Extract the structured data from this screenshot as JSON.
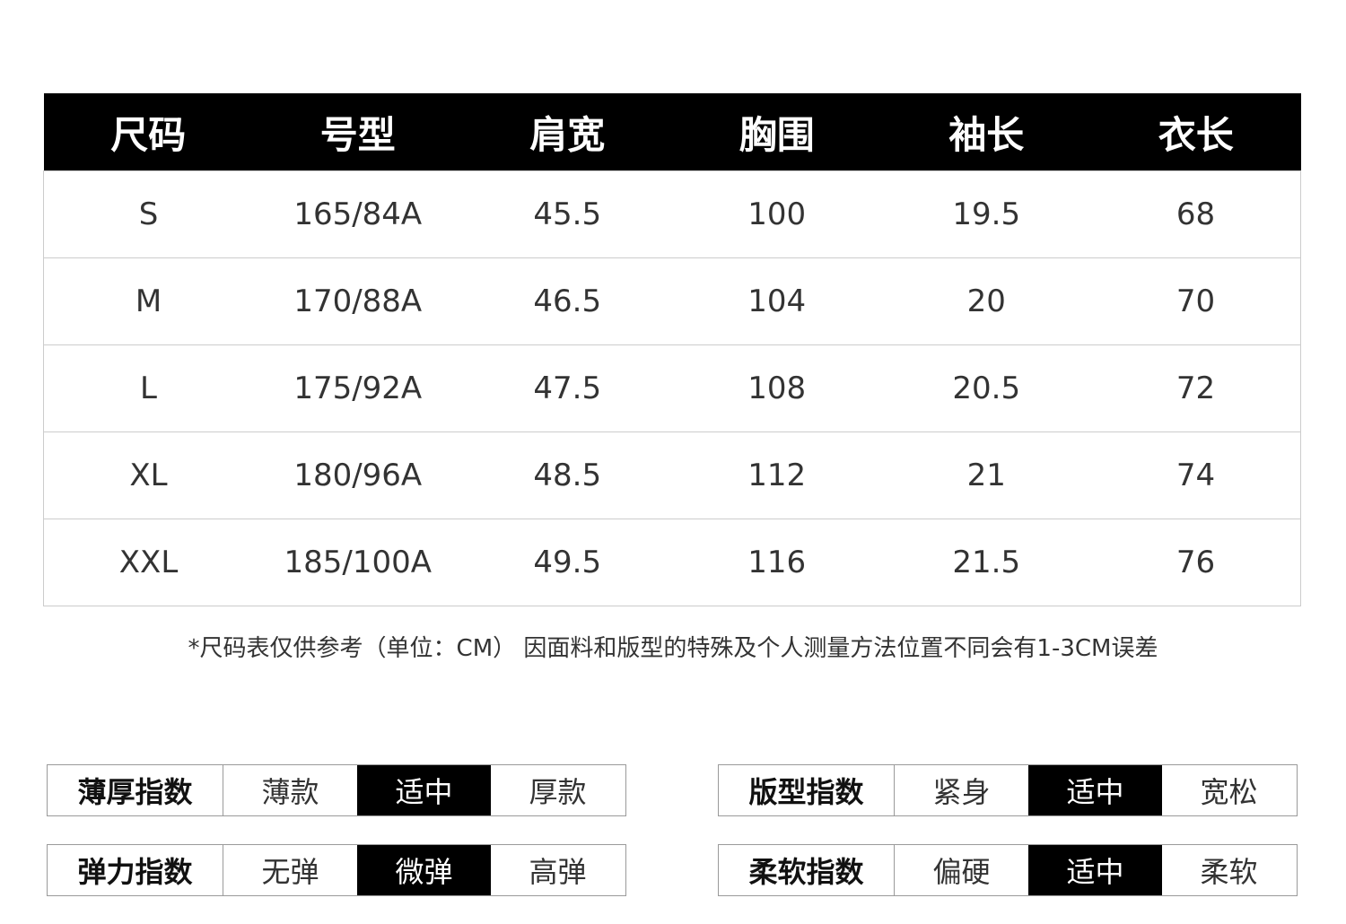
{
  "size_table": {
    "headers": [
      "尺码",
      "号型",
      "肩宽",
      "胸围",
      "袖长",
      "衣长"
    ],
    "rows": [
      [
        "S",
        "165/84A",
        "45.5",
        "100",
        "19.5",
        "68"
      ],
      [
        "M",
        "170/88A",
        "46.5",
        "104",
        "20",
        "70"
      ],
      [
        "L",
        "175/92A",
        "47.5",
        "108",
        "20.5",
        "72"
      ],
      [
        "XL",
        "180/96A",
        "48.5",
        "112",
        "21",
        "74"
      ],
      [
        "XXL",
        "185/100A",
        "49.5",
        "116",
        "21.5",
        "76"
      ]
    ]
  },
  "note": "*尺码表仅供参考（单位：CM） 因面料和版型的特殊及个人测量方法位置不同会有1-3CM误差",
  "indices": {
    "thickness": {
      "label": "薄厚指数",
      "options": [
        "薄款",
        "适中",
        "厚款"
      ],
      "selected": 1
    },
    "fit": {
      "label": "版型指数",
      "options": [
        "紧身",
        "适中",
        "宽松"
      ],
      "selected": 1
    },
    "elastic": {
      "label": "弹力指数",
      "options": [
        "无弹",
        "微弹",
        "高弹"
      ],
      "selected": 1
    },
    "softness": {
      "label": "柔软指数",
      "options": [
        "偏硬",
        "适中",
        "柔软"
      ],
      "selected": 1
    }
  }
}
